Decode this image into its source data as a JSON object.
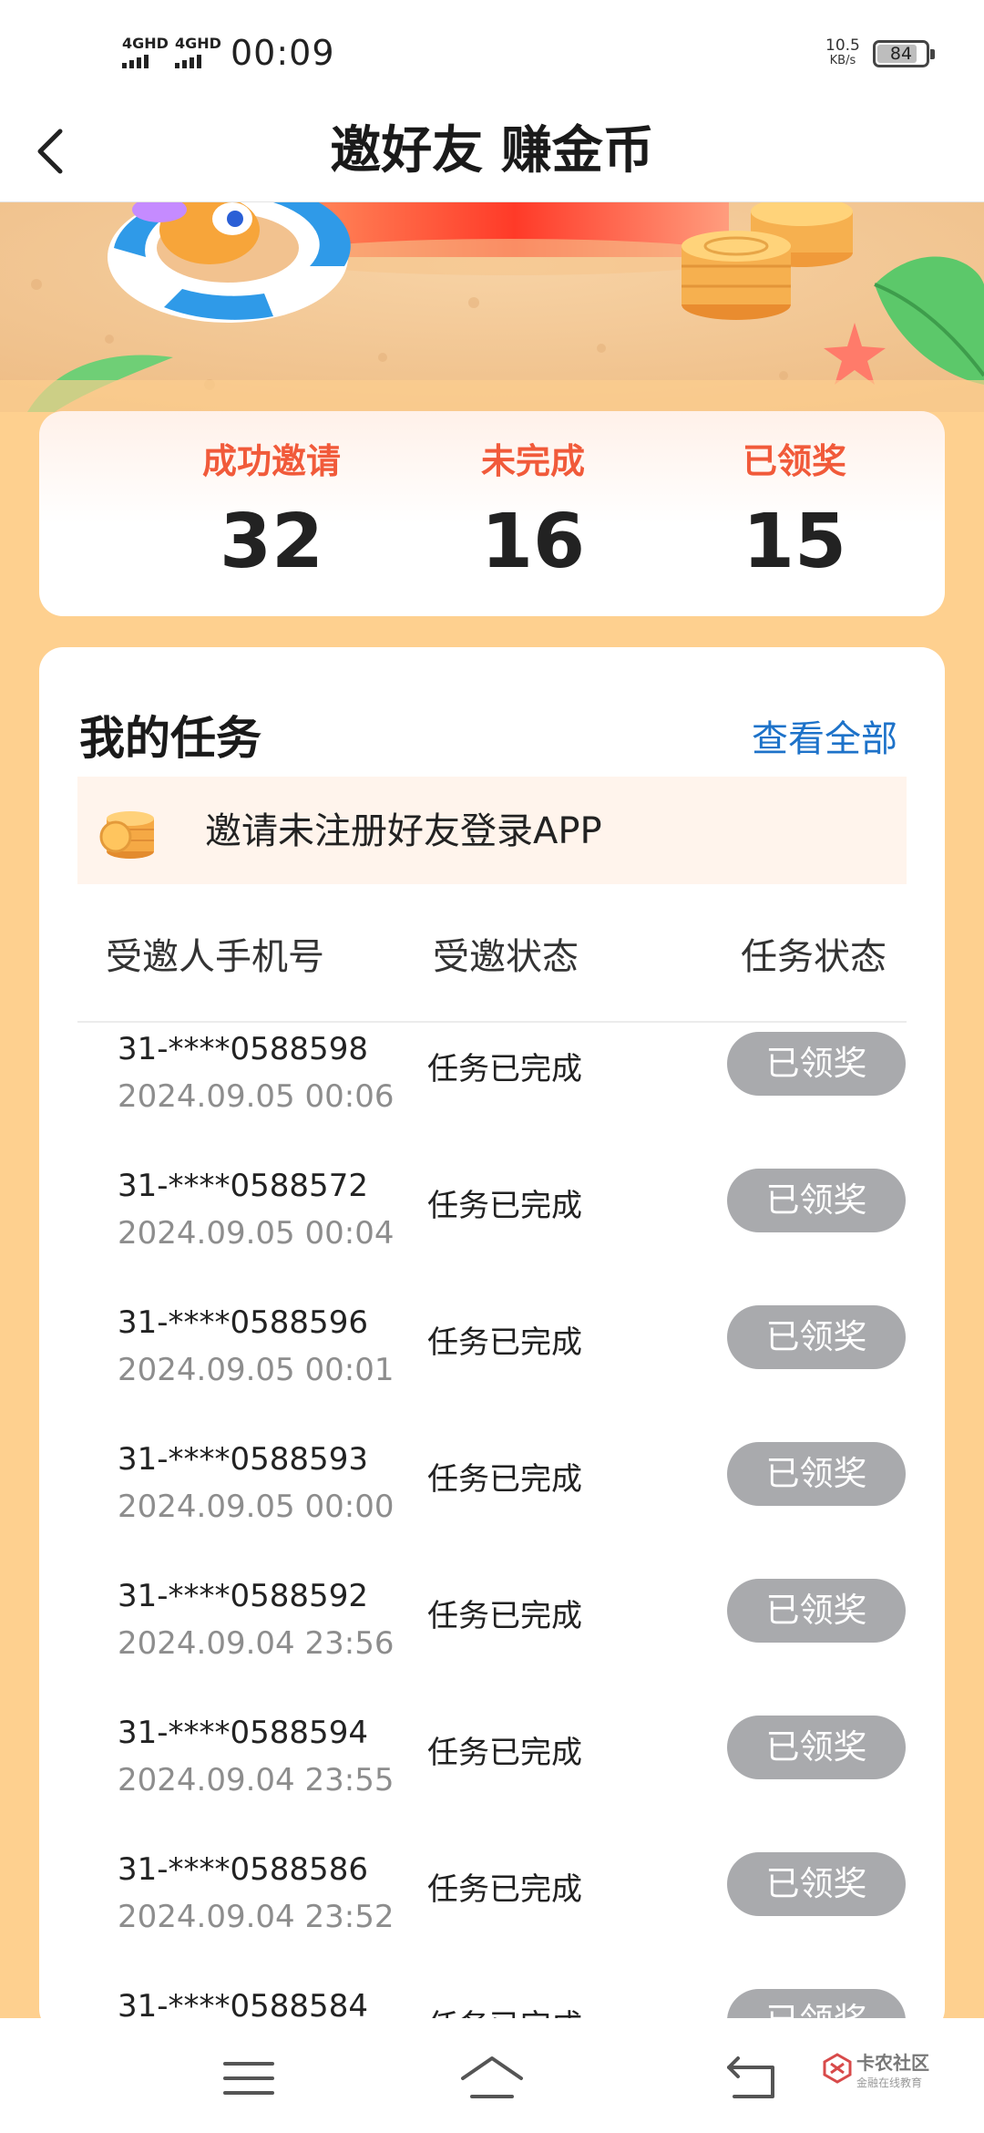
{
  "status_bar": {
    "signal_1": "4GHD",
    "signal_2": "4GHD",
    "time": "00:09",
    "net_speed_value": "10.5",
    "net_speed_unit": "KB/s",
    "battery_level": "84"
  },
  "header": {
    "title": "邀好友 赚金币"
  },
  "stats": [
    {
      "label": "成功邀请",
      "value": "32"
    },
    {
      "label": "未完成",
      "value": "16"
    },
    {
      "label": "已领奖",
      "value": "15"
    }
  ],
  "tasks": {
    "title": "我的任务",
    "view_all": "查看全部",
    "notice": "邀请未注册好友登录APP",
    "columns": [
      "受邀人手机号",
      "受邀状态",
      "任务状态"
    ],
    "rows": [
      {
        "phone": "31-****0588598",
        "date": "2024.09.05 00:06",
        "status": "任务已完成",
        "action": "已领奖"
      },
      {
        "phone": "31-****0588572",
        "date": "2024.09.05 00:04",
        "status": "任务已完成",
        "action": "已领奖"
      },
      {
        "phone": "31-****0588596",
        "date": "2024.09.05 00:01",
        "status": "任务已完成",
        "action": "已领奖"
      },
      {
        "phone": "31-****0588593",
        "date": "2024.09.05 00:00",
        "status": "任务已完成",
        "action": "已领奖"
      },
      {
        "phone": "31-****0588592",
        "date": "2024.09.04 23:56",
        "status": "任务已完成",
        "action": "已领奖"
      },
      {
        "phone": "31-****0588594",
        "date": "2024.09.04 23:55",
        "status": "任务已完成",
        "action": "已领奖"
      },
      {
        "phone": "31-****0588586",
        "date": "2024.09.04 23:52",
        "status": "任务已完成",
        "action": "已领奖"
      },
      {
        "phone": "31-****0588584",
        "date": "",
        "status": "任务已完成",
        "action": "已领奖"
      }
    ]
  },
  "watermark": {
    "name": "卡农社区",
    "sub": "金融在线教育"
  },
  "icons": {
    "back": "chevron-left-icon",
    "menu": "menu-icon",
    "home": "home-icon",
    "return": "return-icon",
    "coin": "coin-stack-icon"
  },
  "colors": {
    "background": "#fed08f",
    "stat_label": "#f15a3a",
    "link": "#1d72c9",
    "claimed_button": "#a9aaad"
  }
}
